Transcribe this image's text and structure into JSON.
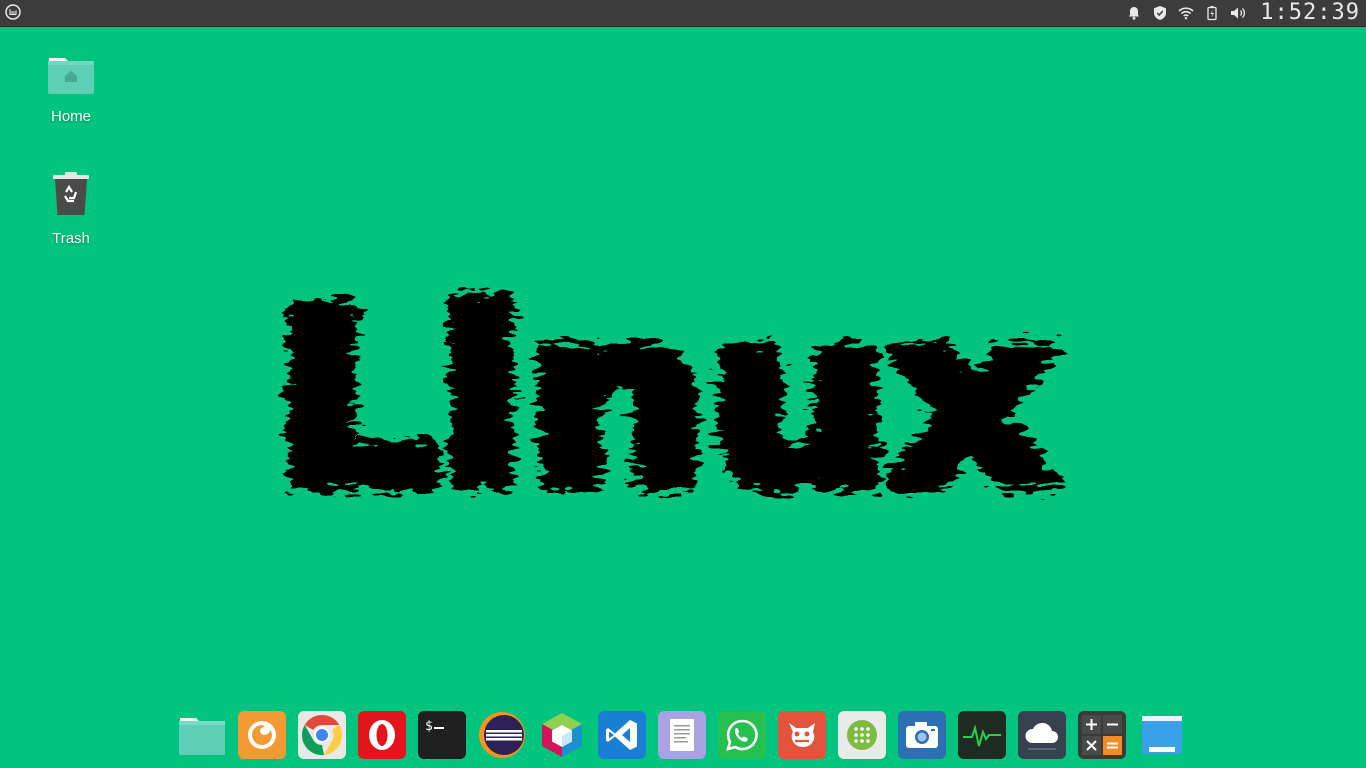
{
  "top_panel": {
    "clock": "1:52:39",
    "tray_icons": [
      "bell-icon",
      "shield-icon",
      "wifi-icon",
      "battery-icon",
      "volume-icon"
    ]
  },
  "desktop": {
    "wallpaper_text": "Linux",
    "background_color": "#03c47e",
    "icons": [
      {
        "label": "Home",
        "icon": "home-folder-icon"
      },
      {
        "label": "Trash",
        "icon": "trash-icon"
      }
    ]
  },
  "dock": {
    "apps": [
      {
        "name": "files",
        "icon": "folder-icon",
        "color": "#5ecfb5"
      },
      {
        "name": "firefox",
        "icon": "firefox-icon",
        "color": "#f39a35"
      },
      {
        "name": "chrome",
        "icon": "chrome-icon",
        "color": "#dd4b39"
      },
      {
        "name": "opera",
        "icon": "opera-icon",
        "color": "#e3141b"
      },
      {
        "name": "terminal",
        "icon": "terminal-icon",
        "color": "#222222"
      },
      {
        "name": "eclipse",
        "icon": "eclipse-icon",
        "color": "#2c2255"
      },
      {
        "name": "netbeans",
        "icon": "netbeans-icon",
        "color": "#63c4e6"
      },
      {
        "name": "vscode",
        "icon": "vscode-icon",
        "color": "#1a7fd4"
      },
      {
        "name": "text-editor",
        "icon": "document-icon",
        "color": "#a9a3e6"
      },
      {
        "name": "whatsapp",
        "icon": "whatsapp-icon",
        "color": "#25c050"
      },
      {
        "name": "gimp",
        "icon": "gimp-icon",
        "color": "#e4543c"
      },
      {
        "name": "app-grid",
        "icon": "app-grid-icon",
        "color": "#eaeaea"
      },
      {
        "name": "screenshot",
        "icon": "camera-icon",
        "color": "#2d6fb5"
      },
      {
        "name": "system-monitor",
        "icon": "system-monitor-icon",
        "color": "#1f2a22"
      },
      {
        "name": "cloud",
        "icon": "cloud-icon",
        "color": "#38414f"
      },
      {
        "name": "calculator",
        "icon": "calculator-icon",
        "color": "#3a3a3a"
      },
      {
        "name": "show-desktop",
        "icon": "show-desktop-icon",
        "color": "#3aa0e8"
      }
    ]
  }
}
